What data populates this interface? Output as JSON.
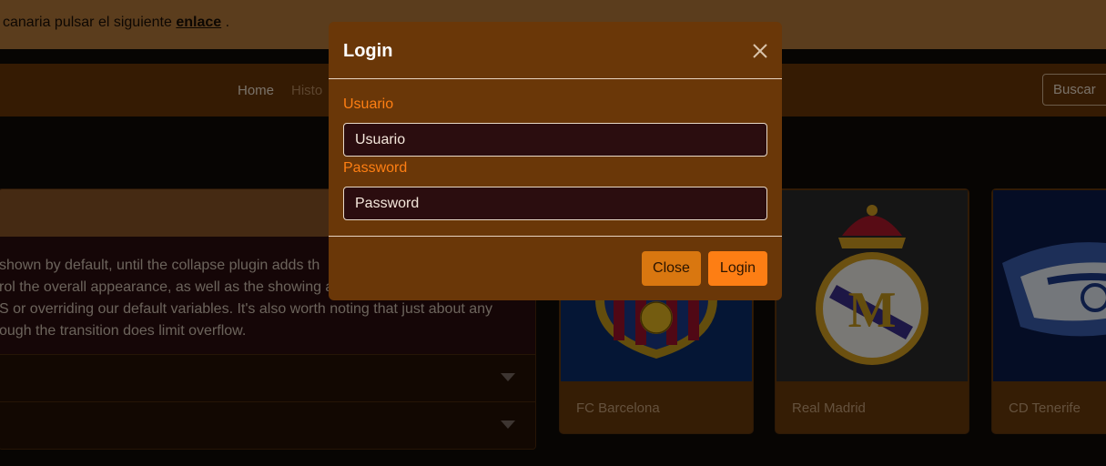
{
  "alert": {
    "text": "canaria pulsar el siguiente ",
    "link": "enlace",
    "suffix": " ."
  },
  "nav": {
    "home": "Home",
    "history": "Histo",
    "search_button": "Buscar"
  },
  "accordion": {
    "body_lines": [
      "shown by default, until the collapse plugin adds th",
      "rol the overall appearance, as well as the showing a",
      "S or overriding our default variables. It's also worth noting that just about any",
      "ough the transition does limit overflow."
    ]
  },
  "cards": [
    {
      "title": "FC Barcelona",
      "icon": "fc-barcelona-crest"
    },
    {
      "title": "Real Madrid",
      "icon": "real-madrid-crest"
    },
    {
      "title": "CD Tenerife",
      "icon": "cd-tenerife-crest"
    }
  ],
  "modal": {
    "title": "Login",
    "user_label": "Usuario",
    "user_placeholder": "Usuario",
    "password_label": "Password",
    "password_placeholder": "Password",
    "close_button": "Close",
    "login_button": "Login"
  },
  "colors": {
    "accent": "#fd7e14",
    "modal_bg": "#6a3708",
    "navbar": "#6b3607"
  }
}
